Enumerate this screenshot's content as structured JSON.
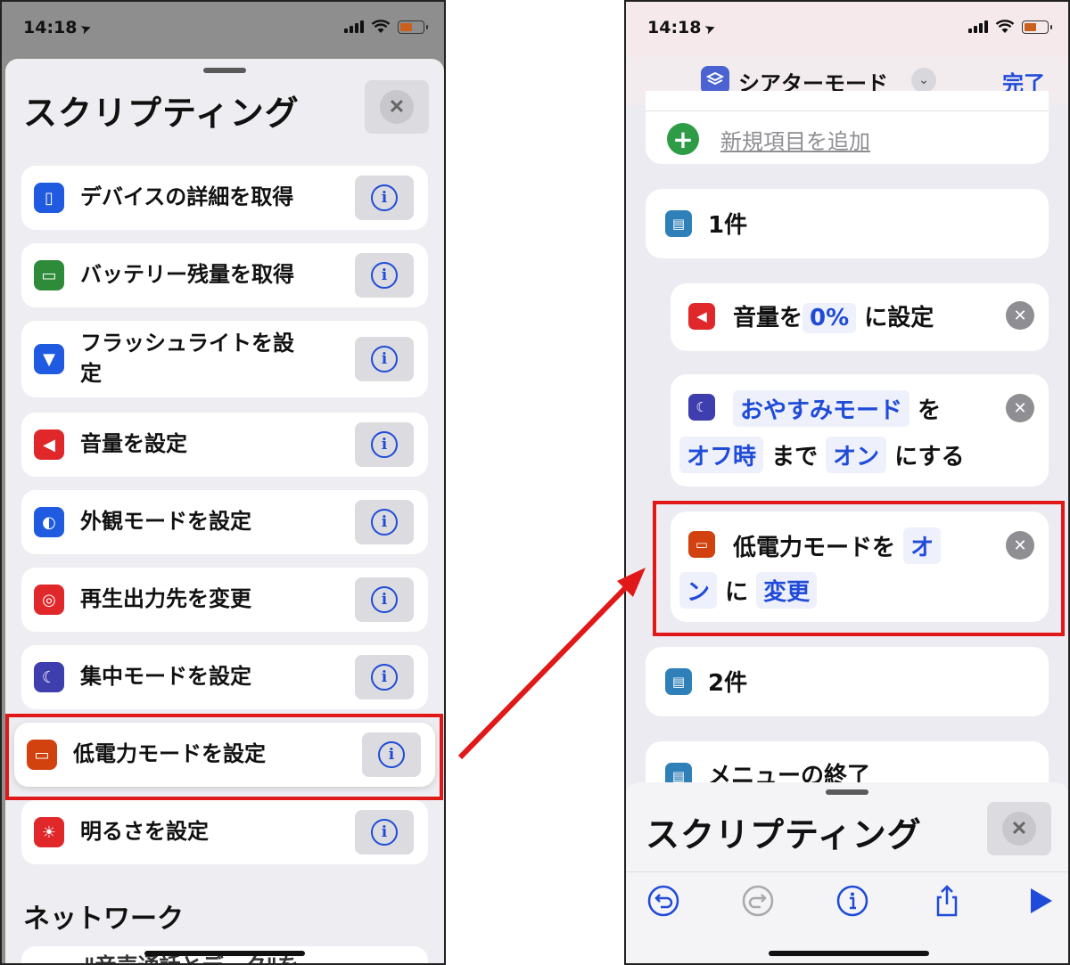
{
  "left": {
    "status": {
      "time": "14:18"
    },
    "sheet_title": "スクリプティング",
    "actions": [
      {
        "label": "デバイスの詳細を取得",
        "color": "#1f5ae0"
      },
      {
        "label": "バッテリー残量を取得",
        "color": "#2e8b3a"
      },
      {
        "label": "フラッシュライトを設定",
        "color": "#1f5ae0"
      },
      {
        "label": "音量を設定",
        "color": "#e0272a"
      },
      {
        "label": "外観モードを設定",
        "color": "#1f5ae0"
      },
      {
        "label": "再生出力先を変更",
        "color": "#e0272a"
      },
      {
        "label": "集中モードを設定",
        "color": "#3f3eae"
      },
      {
        "label": "低電力モードを設定",
        "color": "#d2420e"
      },
      {
        "label": "明るさを設定",
        "color": "#e0272a"
      }
    ],
    "section_title": "ネットワーク",
    "next_item_partial": "\"音声通話とデータ\"を"
  },
  "right": {
    "status": {
      "time": "14:18"
    },
    "nav": {
      "title": "シアターモード",
      "done": "完了"
    },
    "add_item": "新規項目を追加",
    "menu_item_1": "1件",
    "volume": {
      "prefix": "音量を",
      "token": "0%",
      "suffix": "に設定"
    },
    "focus": {
      "token1": "おやすみモード",
      "text1": "を",
      "token2": "オフ時",
      "text2": "まで",
      "token3": "オン",
      "text3": "にする"
    },
    "low_power": {
      "prefix": "低電力モードを",
      "token1a": "オ",
      "token1b": "ン",
      "text": "に",
      "token2": "変更"
    },
    "menu_item_2": "2件",
    "menu_end": "メニューの終了",
    "sheet_title": "スクリプティング"
  },
  "colors": {
    "accent_blue": "#1f4bd8",
    "highlight_red": "#e01818",
    "sheet_bg": "#eeeef2"
  }
}
